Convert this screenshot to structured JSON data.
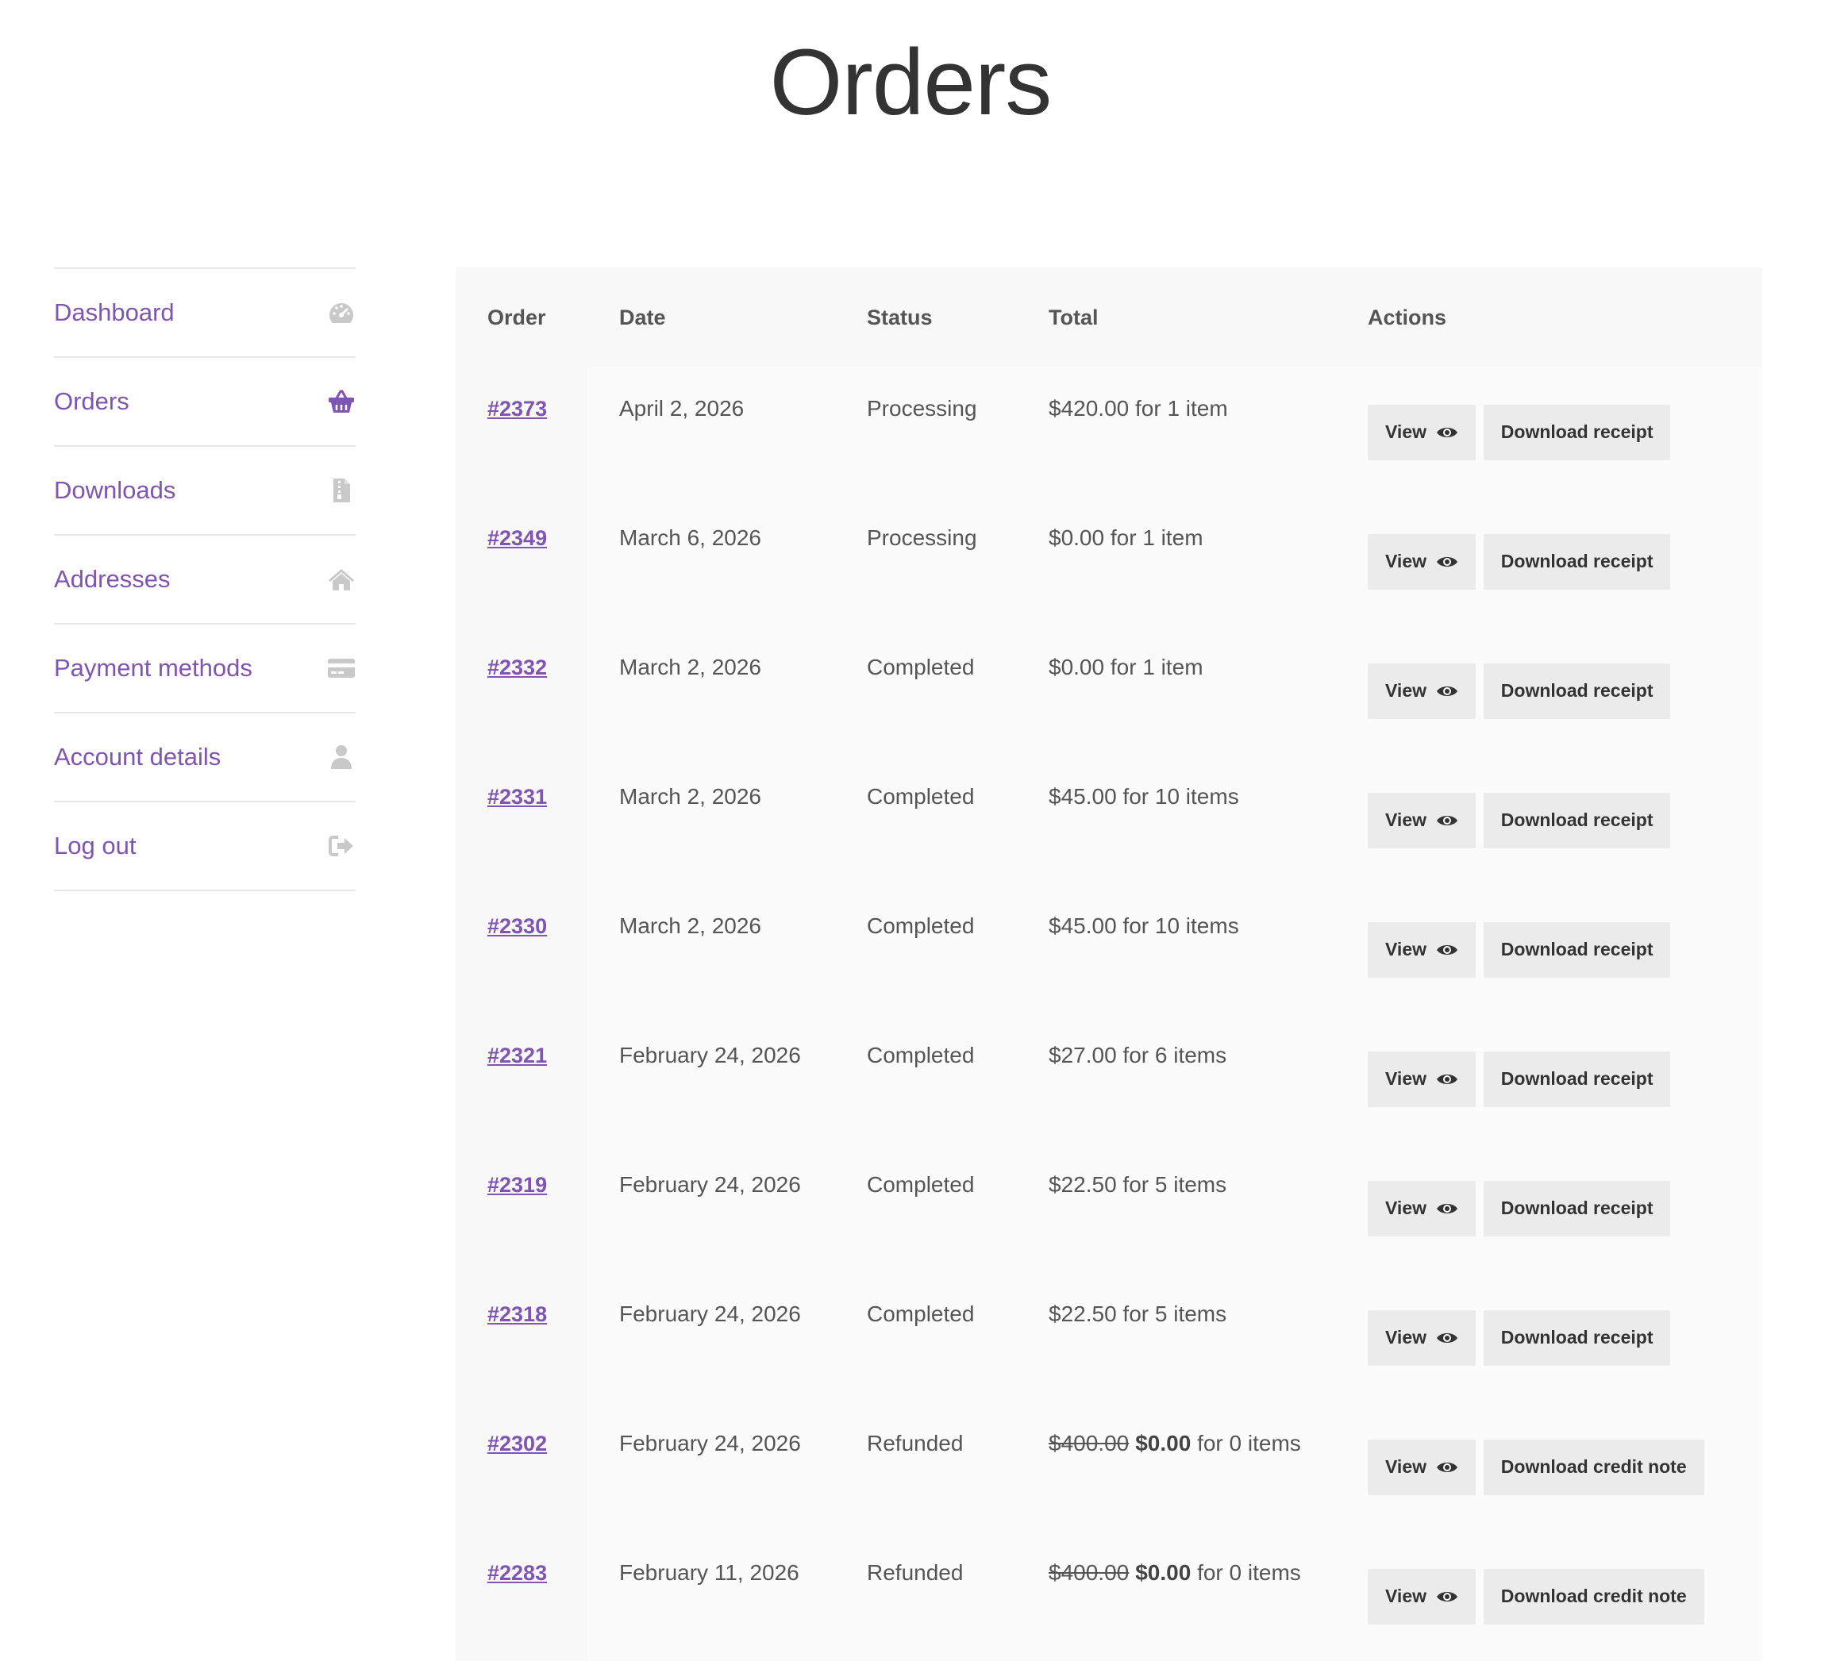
{
  "page": {
    "title": "Orders"
  },
  "sidebar": {
    "items": [
      {
        "label": "Dashboard",
        "icon": "dashboard-gauge-icon",
        "active": false
      },
      {
        "label": "Orders",
        "icon": "basket-icon",
        "active": true
      },
      {
        "label": "Downloads",
        "icon": "file-archive-icon",
        "active": false
      },
      {
        "label": "Addresses",
        "icon": "home-icon",
        "active": false
      },
      {
        "label": "Payment methods",
        "icon": "credit-card-icon",
        "active": false
      },
      {
        "label": "Account details",
        "icon": "user-icon",
        "active": false
      },
      {
        "label": "Log out",
        "icon": "logout-icon",
        "active": false
      }
    ],
    "colors": {
      "link": "#7f54b3",
      "icon_inactive": "#c9c9c9",
      "icon_active": "#7f54b3"
    }
  },
  "table": {
    "headers": {
      "order": "Order",
      "date": "Date",
      "status": "Status",
      "total": "Total",
      "actions": "Actions"
    },
    "view_label": "View",
    "rows": [
      {
        "order": "#2373",
        "date": "April 2, 2026",
        "status": "Processing",
        "total_struck": "",
        "total_amount": "$420.00",
        "total_suffix": " for 1 item",
        "download_label": "Download receipt"
      },
      {
        "order": "#2349",
        "date": "March 6, 2026",
        "status": "Processing",
        "total_struck": "",
        "total_amount": "$0.00",
        "total_suffix": " for 1 item",
        "download_label": "Download receipt"
      },
      {
        "order": "#2332",
        "date": "March 2, 2026",
        "status": "Completed",
        "total_struck": "",
        "total_amount": "$0.00",
        "total_suffix": " for 1 item",
        "download_label": "Download receipt"
      },
      {
        "order": "#2331",
        "date": "March 2, 2026",
        "status": "Completed",
        "total_struck": "",
        "total_amount": "$45.00",
        "total_suffix": " for 10 items",
        "download_label": "Download receipt"
      },
      {
        "order": "#2330",
        "date": "March 2, 2026",
        "status": "Completed",
        "total_struck": "",
        "total_amount": "$45.00",
        "total_suffix": " for 10 items",
        "download_label": "Download receipt"
      },
      {
        "order": "#2321",
        "date": "February 24, 2026",
        "status": "Completed",
        "total_struck": "",
        "total_amount": "$27.00",
        "total_suffix": " for 6 items",
        "download_label": "Download receipt"
      },
      {
        "order": "#2319",
        "date": "February 24, 2026",
        "status": "Completed",
        "total_struck": "",
        "total_amount": "$22.50",
        "total_suffix": " for 5 items",
        "download_label": "Download receipt"
      },
      {
        "order": "#2318",
        "date": "February 24, 2026",
        "status": "Completed",
        "total_struck": "",
        "total_amount": "$22.50",
        "total_suffix": " for 5 items",
        "download_label": "Download receipt"
      },
      {
        "order": "#2302",
        "date": "February 24, 2026",
        "status": "Refunded",
        "total_struck": "$400.00",
        "total_amount": "$0.00",
        "total_suffix": " for 0 items",
        "download_label": "Download credit note"
      },
      {
        "order": "#2283",
        "date": "February 11, 2026",
        "status": "Refunded",
        "total_struck": "$400.00",
        "total_amount": "$0.00",
        "total_suffix": " for 0 items",
        "download_label": "Download credit note"
      }
    ]
  }
}
